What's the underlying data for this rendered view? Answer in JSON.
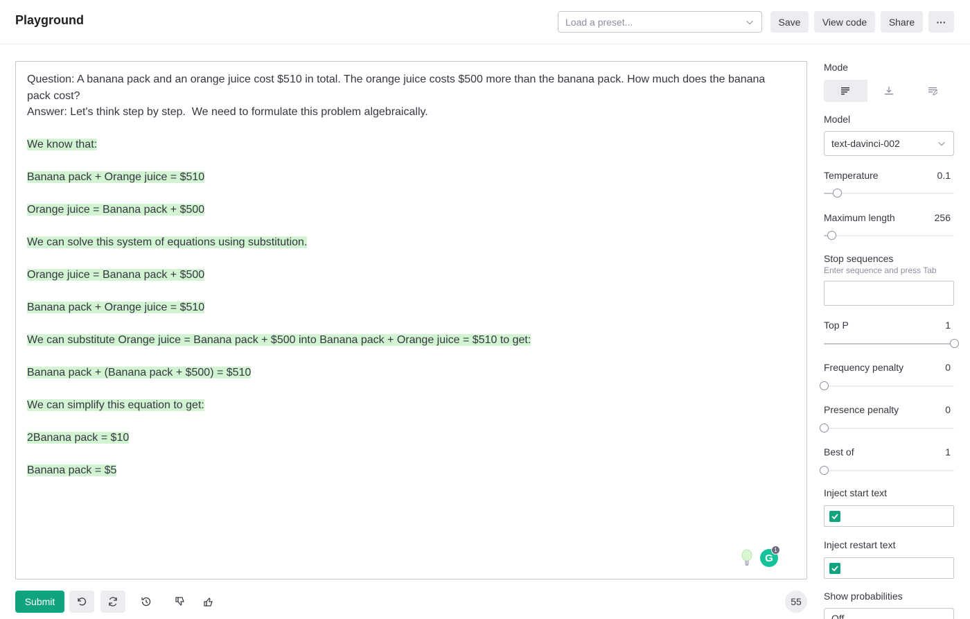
{
  "header": {
    "title": "Playground",
    "preset_placeholder": "Load a preset...",
    "save_label": "Save",
    "view_code_label": "View code",
    "share_label": "Share",
    "more_label": "···"
  },
  "editor": {
    "prompt": "Question: A banana pack and an orange juice cost $510 in total. The orange juice costs $500 more than the banana pack. How much does the banana pack cost?\nAnswer: Let's think step by step.  We need to formulate this problem algebraically.\n",
    "completion_lines": [
      "We know that:",
      "Banana pack + Orange juice = $510",
      "Orange juice = Banana pack + $500",
      "We can solve this system of equations using substitution.",
      "Orange juice = Banana pack + $500",
      "Banana pack + Orange juice = $510",
      "We can substitute Orange juice = Banana pack + $500 into Banana pack + Orange juice = $510 to get:",
      "Banana pack + (Banana pack + $500) = $510",
      "We can simplify this equation to get:",
      "2Banana pack = $10",
      "Banana pack = $5"
    ],
    "grammarly_letter": "G",
    "grammarly_count": "1"
  },
  "toolbar": {
    "submit_label": "Submit",
    "token_count": "55"
  },
  "settings": {
    "mode_label": "Mode",
    "model_label": "Model",
    "model_value": "text-davinci-002",
    "temperature_label": "Temperature",
    "temperature_value": "0.1",
    "temperature_level": 0.1,
    "max_length_label": "Maximum length",
    "max_length_value": "256",
    "max_length_level": 0.06,
    "stop_label": "Stop sequences",
    "stop_hint": "Enter sequence and press Tab",
    "top_p_label": "Top P",
    "top_p_value": "1",
    "top_p_level": 1.0,
    "freq_label": "Frequency penalty",
    "freq_value": "0",
    "freq_level": 0.0,
    "pres_label": "Presence penalty",
    "pres_value": "0",
    "pres_level": 0.0,
    "best_of_label": "Best of",
    "best_of_value": "1",
    "best_of_level": 0.0,
    "inject_start_label": "Inject start text",
    "inject_start_checked": true,
    "inject_restart_label": "Inject restart text",
    "inject_restart_checked": true,
    "show_prob_label": "Show probabilities",
    "show_prob_value": "Off"
  },
  "colors": {
    "accent": "#10a37f",
    "highlight": "#d2f4d3"
  }
}
